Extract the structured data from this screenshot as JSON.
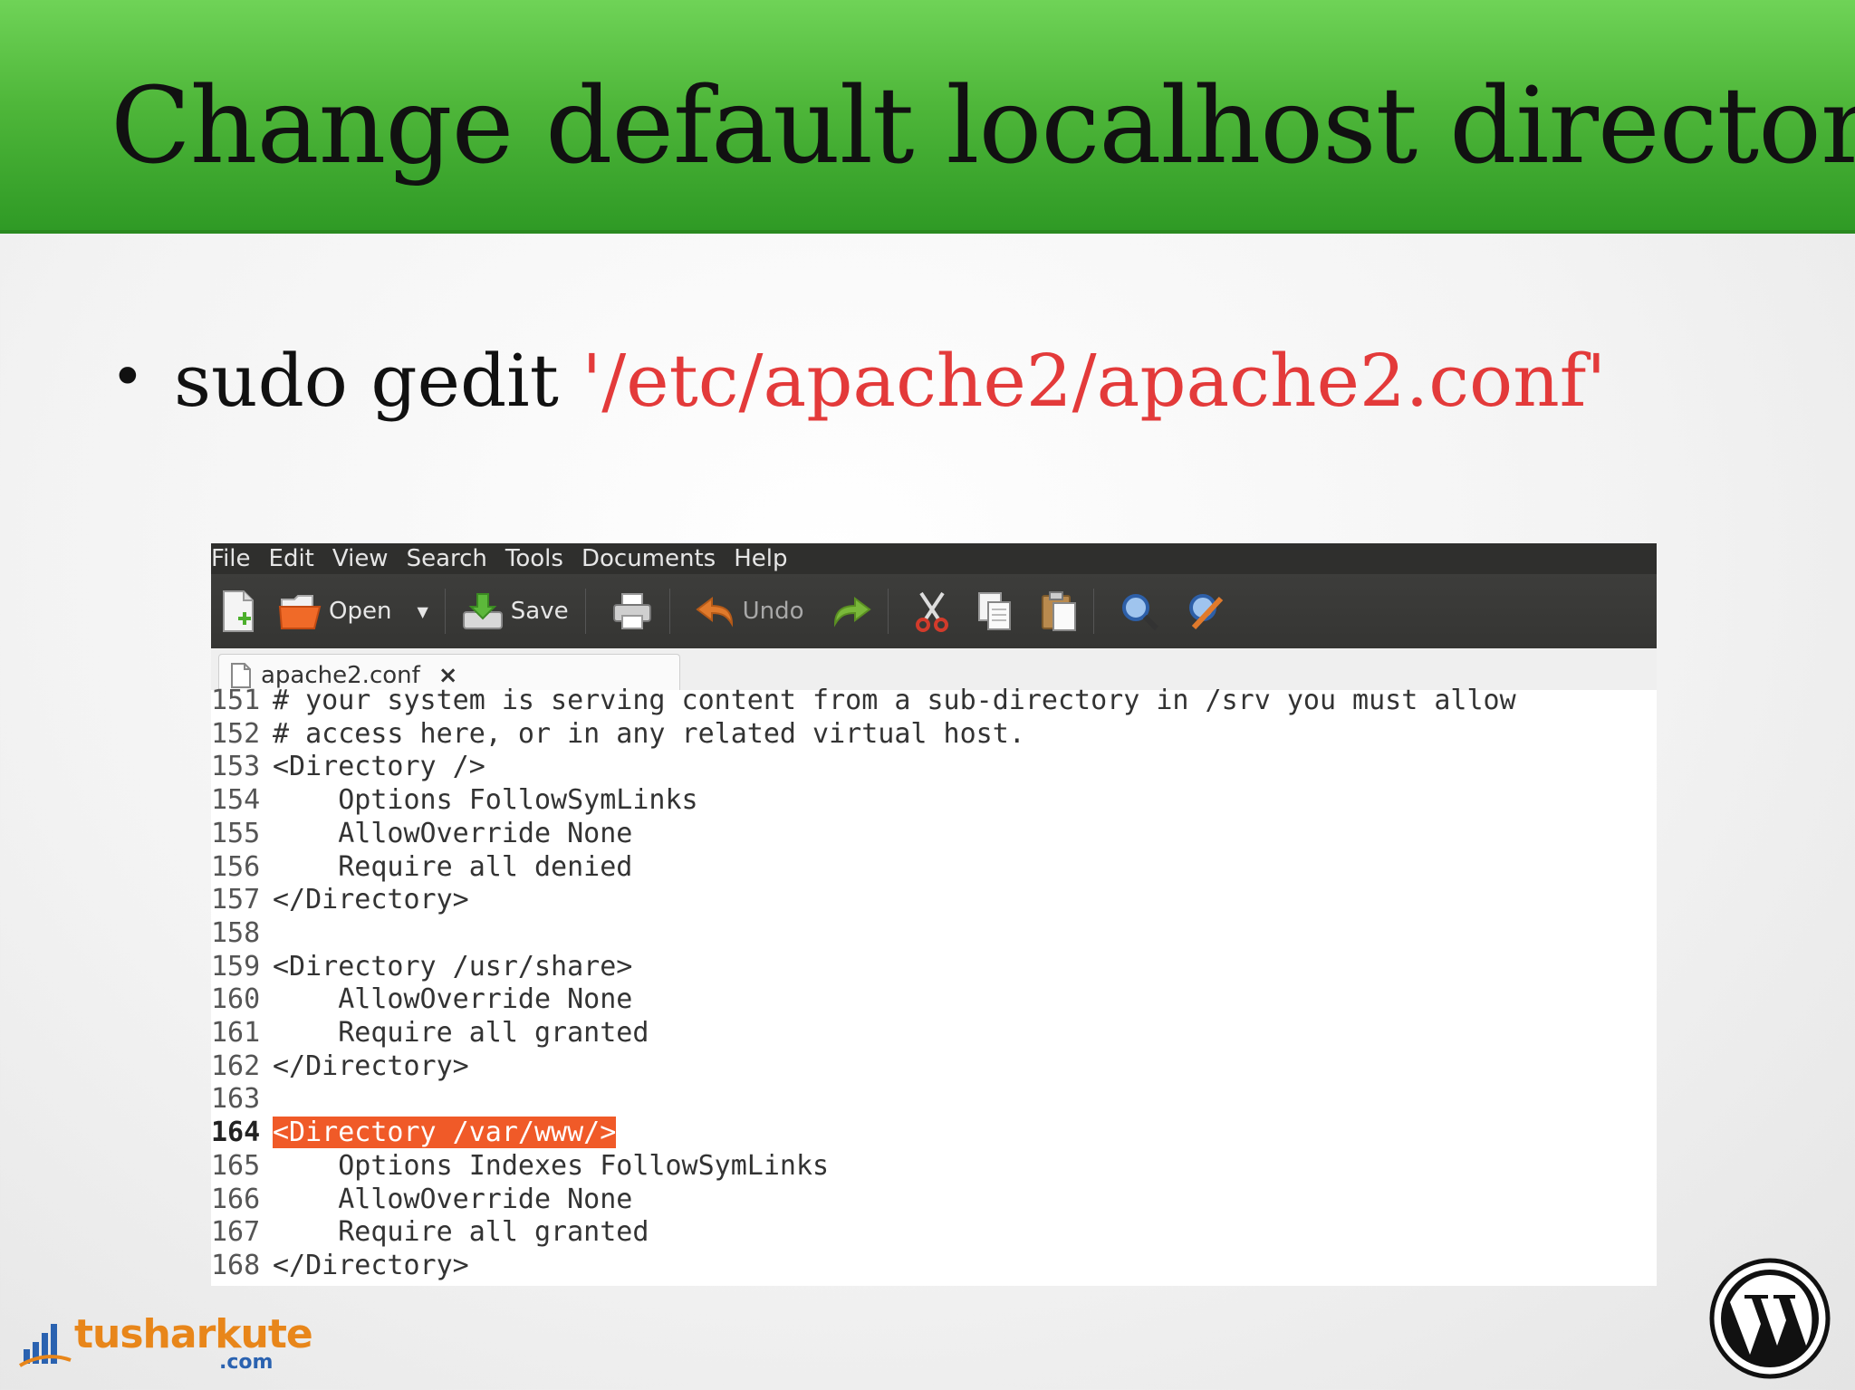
{
  "slide": {
    "title": "Change default localhost directory",
    "bullet": {
      "symbol": "•",
      "command": "sudo gedit ",
      "path": "'/etc/apache2/apache2.conf'"
    }
  },
  "gedit": {
    "menu": [
      "File",
      "Edit",
      "View",
      "Search",
      "Tools",
      "Documents",
      "Help"
    ],
    "toolbar": {
      "open_label": "Open",
      "save_label": "Save",
      "undo_label": "Undo"
    },
    "tab": {
      "label": "apache2.conf",
      "close": "×"
    },
    "lines": [
      {
        "n": "151",
        "text": "# your system is serving content from a sub-directory in /srv you must allow"
      },
      {
        "n": "152",
        "text": "# access here, or in any related virtual host."
      },
      {
        "n": "153",
        "text": "<Directory />"
      },
      {
        "n": "154",
        "text": "    Options FollowSymLinks"
      },
      {
        "n": "155",
        "text": "    AllowOverride None"
      },
      {
        "n": "156",
        "text": "    Require all denied"
      },
      {
        "n": "157",
        "text": "</Directory>"
      },
      {
        "n": "158",
        "text": ""
      },
      {
        "n": "159",
        "text": "<Directory /usr/share>"
      },
      {
        "n": "160",
        "text": "    AllowOverride None"
      },
      {
        "n": "161",
        "text": "    Require all granted"
      },
      {
        "n": "162",
        "text": "</Directory>"
      },
      {
        "n": "163",
        "text": ""
      },
      {
        "n": "164",
        "text": "<Directory /var/www/>"
      },
      {
        "n": "165",
        "text": "    Options Indexes FollowSymLinks"
      },
      {
        "n": "166",
        "text": "    AllowOverride None"
      },
      {
        "n": "167",
        "text": "    Require all granted"
      },
      {
        "n": "168",
        "text": "</Directory>"
      }
    ],
    "current_line": "164",
    "highlight_color": "#f05a28"
  },
  "branding": {
    "tusharkute_name": "tusharkute",
    "tusharkute_domain": ".com"
  },
  "colors": {
    "title_green": "#4fb73a",
    "path_red": "#e33a3a",
    "tusharkute_orange": "#e8861a",
    "tusharkute_blue": "#2a62b0"
  }
}
